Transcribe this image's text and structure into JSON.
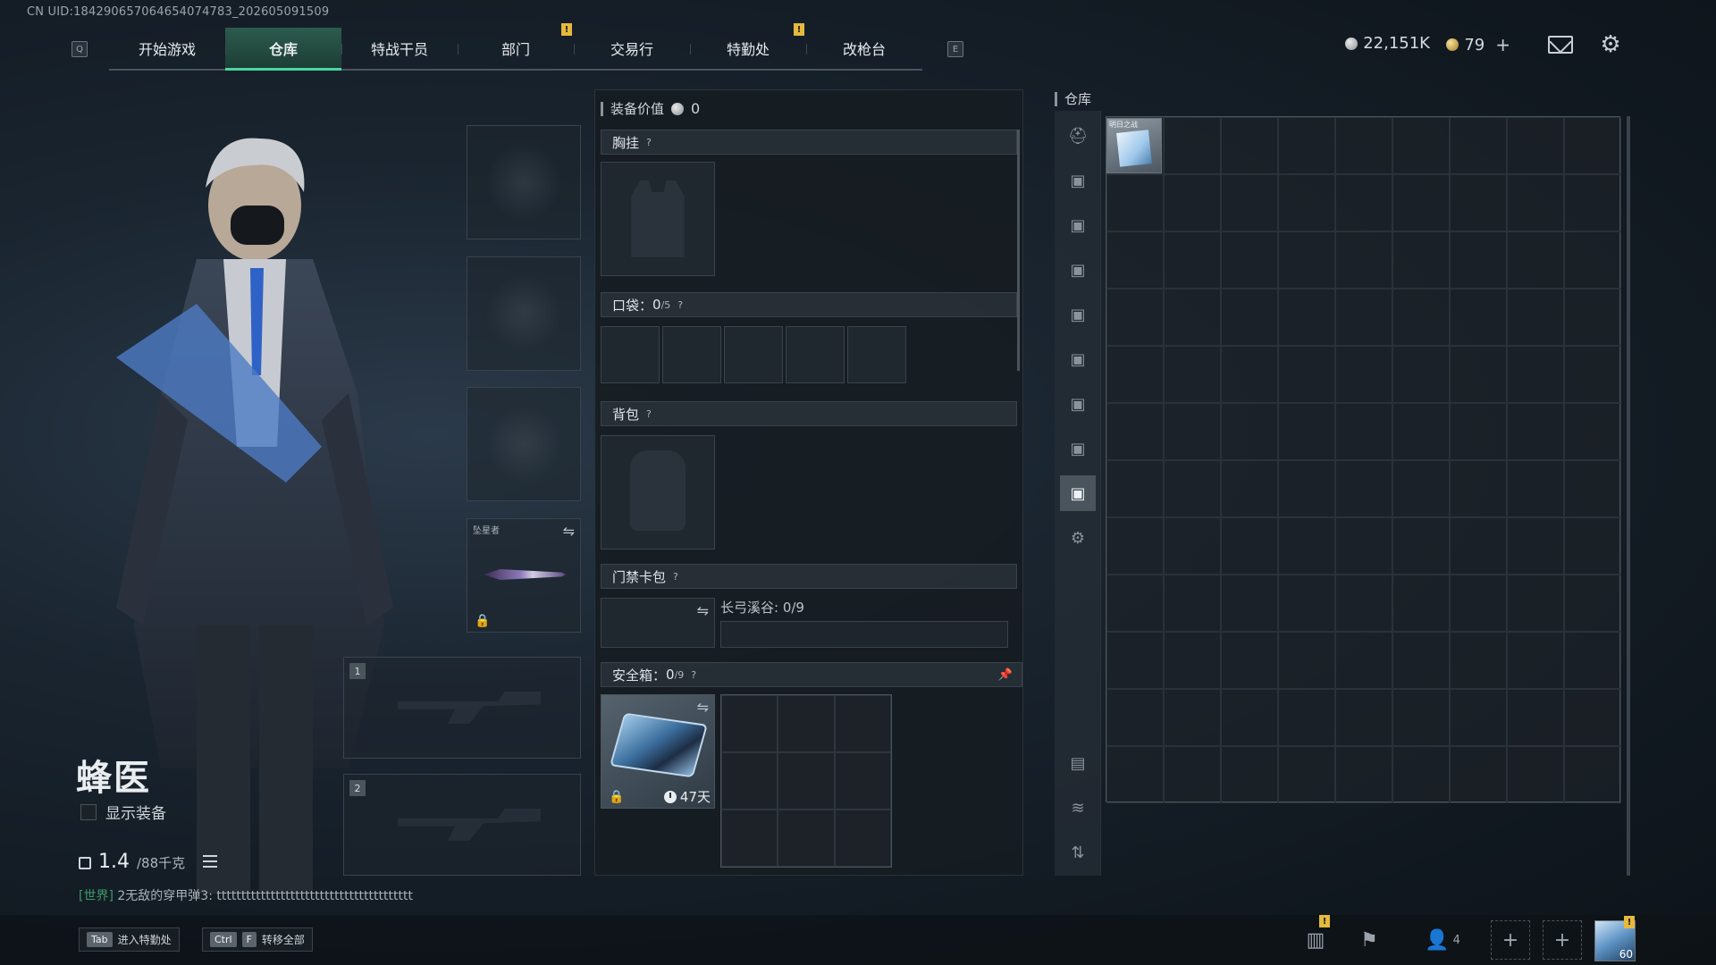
{
  "uid": "CN UID:184290657064654074783_202605091509",
  "nav": {
    "left_key": "Q",
    "right_key": "E",
    "tabs": [
      {
        "label": "开始游戏",
        "badge": ""
      },
      {
        "label": "仓库",
        "badge": "",
        "active": true
      },
      {
        "label": "特战干员",
        "badge": ""
      },
      {
        "label": "部门",
        "badge": "!"
      },
      {
        "label": "交易行",
        "badge": ""
      },
      {
        "label": "特勤处",
        "badge": "!"
      },
      {
        "label": "改枪台",
        "badge": ""
      }
    ]
  },
  "currency": {
    "silver": "22,151K",
    "gold": "79",
    "plus": "+"
  },
  "character": {
    "name": "蜂医",
    "show_equipment": "显示装备",
    "weight_value": "1.4",
    "weight_max": "/88千克"
  },
  "chat": {
    "channel": "[世界]",
    "message": "2无敌的穿甲弹3: tttttttttttttttttttttttttttttttttttttttt"
  },
  "equip_slots": {
    "melee_label": "坠星者",
    "weapon1": "1",
    "weapon2": "2"
  },
  "gear": {
    "value_label": "装备价值",
    "value": "0",
    "chest_rig": "胸挂",
    "pockets_label": "口袋：",
    "pockets_used": "0",
    "pockets_cap": "/5",
    "backpack": "背包",
    "keycard": "门禁卡包",
    "keycard_sub": "长弓溪谷: 0/9",
    "safebox_label": "安全箱：",
    "safebox_used": "0",
    "safebox_cap": "/9",
    "safebox_timer": "47天",
    "help": "?"
  },
  "warehouse": {
    "title": "仓库",
    "item_label": "明日之战"
  },
  "bottom": {
    "hint1_key": "Tab",
    "hint1_text": "进入特勤处",
    "hint2_key1": "Ctrl",
    "hint2_key2": "F",
    "hint2_text": "转移全部",
    "squad_count": "4",
    "avatar_level": "60"
  },
  "colors": {
    "accent": "#49d6a2",
    "badge": "#e5b93c",
    "chat": "#3f9a6a"
  }
}
